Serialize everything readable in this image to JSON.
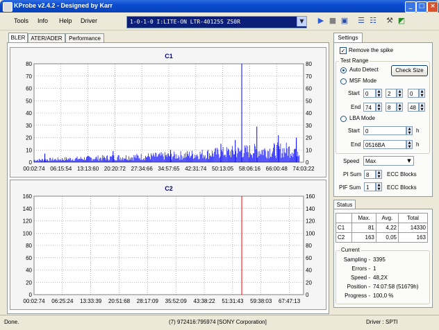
{
  "window": {
    "title": "KProbe v2.4.2 - Designed by Karr",
    "minimize": "_",
    "maximize": "□",
    "close": "×"
  },
  "menu": [
    "Tools",
    "Info",
    "Help",
    "Driver"
  ],
  "drive": {
    "selected": "1-0-1-0 I:LITE-ON LTR-40125S          ZS0R"
  },
  "toolbar_icons": [
    "play-icon",
    "stop-icon",
    "save-icon",
    "view-icon",
    "view-icon",
    "tools-icon",
    "graph-icon"
  ],
  "tabs": {
    "left": [
      "BLER",
      "ATER/ADER",
      "Performance"
    ],
    "right": "Settings",
    "status": "Status"
  },
  "chart_data": [
    {
      "type": "bar",
      "title": "C1",
      "ylim": [
        0,
        80
      ],
      "yticks": [
        0,
        10,
        20,
        30,
        40,
        50,
        60,
        70,
        80
      ],
      "xticks": [
        "00:02:74",
        "06:15:54",
        "13:13:60",
        "20:20:72",
        "27:34:66",
        "34:57:65",
        "42:31:74",
        "50:13:05",
        "58:06:16",
        "66:00:48",
        "74:03:22"
      ],
      "x_range_minutes": [
        0,
        75
      ],
      "baseline_series": [
        {
          "minute": 0,
          "value": 2
        },
        {
          "minute": 10,
          "value": 3
        },
        {
          "minute": 20,
          "value": 4
        },
        {
          "minute": 30,
          "value": 5
        },
        {
          "minute": 40,
          "value": 6
        },
        {
          "minute": 50,
          "value": 8
        },
        {
          "minute": 60,
          "value": 10
        },
        {
          "minute": 70,
          "value": 11
        },
        {
          "minute": 74,
          "value": 12
        }
      ],
      "spikes": [
        {
          "minute": 3,
          "value": 7
        },
        {
          "minute": 22,
          "value": 9
        },
        {
          "minute": 38,
          "value": 10
        },
        {
          "minute": 52,
          "value": 15
        },
        {
          "minute": 56,
          "value": 18
        },
        {
          "minute": 57.8,
          "value": 81
        },
        {
          "minute": 62,
          "value": 29
        },
        {
          "minute": 68,
          "value": 22
        },
        {
          "minute": 73,
          "value": 20
        }
      ],
      "color": "#0000ff"
    },
    {
      "type": "bar",
      "title": "C2",
      "ylim": [
        0,
        160
      ],
      "yticks": [
        0,
        20,
        40,
        60,
        80,
        100,
        120,
        140,
        160
      ],
      "xticks": [
        "00:02:74",
        "06:25:24",
        "13:33:39",
        "20:51:68",
        "28:17:09",
        "35:52:09",
        "43:38:22",
        "51:31:43",
        "59:38:03",
        "67:47:13"
      ],
      "x_range_minutes": [
        0,
        75
      ],
      "spikes": [
        {
          "minute": 57.8,
          "value": 163
        }
      ],
      "color": "#ff0000"
    }
  ],
  "settings": {
    "remove_spike": "Remove the spike",
    "test_range": "Test Range",
    "auto_detect": "Auto Detect",
    "check_size": "Check Size",
    "msf_mode": "MSF Mode",
    "start_label": "Start",
    "end_label": "End",
    "msf_start": [
      "0",
      "2",
      "0"
    ],
    "msf_end": [
      "74",
      "8",
      "48"
    ],
    "lba_mode": "LBA Mode",
    "lba_start": "0",
    "lba_end": "0516BA",
    "h": "h",
    "speed_label": "Speed",
    "speed_value": "Max",
    "pi_sum_label": "PI Sum",
    "pi_sum_value": "8",
    "pif_sum_label": "PIF Sum",
    "pif_sum_value": "1",
    "ecc_blocks": "ECC Blocks"
  },
  "status": {
    "headers": [
      "",
      "Max.",
      "Avg.",
      "Total"
    ],
    "rows": [
      [
        "C1",
        "81",
        "4,22",
        "14330"
      ],
      [
        "C2",
        "163",
        "0,05",
        "163"
      ]
    ],
    "current_label": "Current",
    "sampling_label": "Sampling -",
    "sampling": "3395",
    "errors_label": "Errors -",
    "errors": "1",
    "speed_label": "Speed -",
    "speed": "48,2X",
    "position_label": "Position -",
    "position": "74:07:58 (51679h)",
    "progress_label": "Progress -",
    "progress": "100,0 %"
  },
  "statusbar": {
    "left": "Done.",
    "middle": "(7) 972416:795974 [SONY Corporation]",
    "right": "Driver : SPTI"
  }
}
